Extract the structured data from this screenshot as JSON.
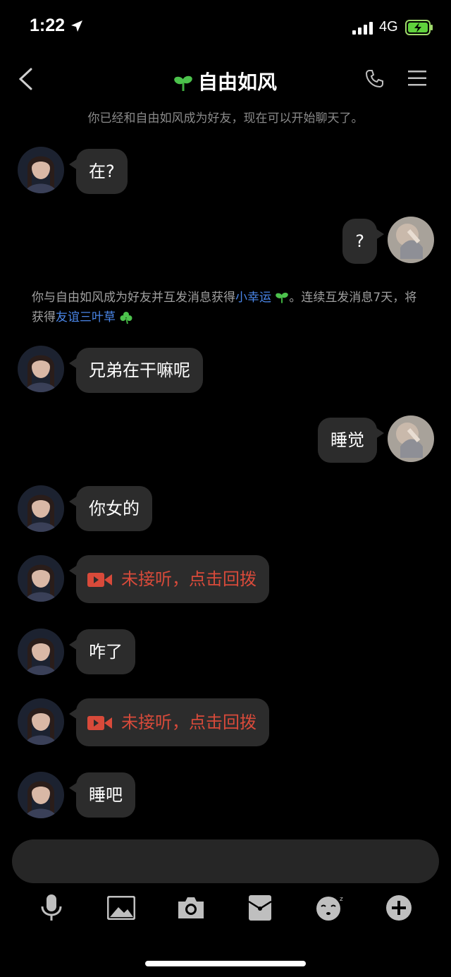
{
  "status_bar": {
    "time": "1:22",
    "network": "4G"
  },
  "header": {
    "title": "自由如风"
  },
  "system_note": "你已经和自由如风成为好友，现在可以开始聊天了。",
  "friend_note": {
    "part1": "你与自由如风成为好友并互发消息获得",
    "link1": "小幸运",
    "part2": "。连续互发消息7天，将获得",
    "link2": "友谊三叶草"
  },
  "messages": [
    {
      "side": "left",
      "text": "在?"
    },
    {
      "side": "right",
      "text": "?"
    },
    {
      "side": "left",
      "text": "兄弟在干嘛呢"
    },
    {
      "side": "right",
      "text": "睡觉"
    },
    {
      "side": "left",
      "text": "你女的"
    },
    {
      "side": "left",
      "type": "missed_call",
      "text": "未接听，点击回拨"
    },
    {
      "side": "left",
      "text": "咋了"
    },
    {
      "side": "left",
      "type": "missed_call",
      "text": "未接听，点击回拨"
    },
    {
      "side": "left",
      "text": "睡吧"
    }
  ],
  "toolbar": [
    "microphone-icon",
    "image-icon",
    "camera-icon",
    "red-packet-icon",
    "emoji-icon",
    "plus-icon"
  ],
  "colors": {
    "accent_link": "#4a86e8",
    "missed_call": "#d84a3a",
    "bubble": "#2c2c2c"
  }
}
